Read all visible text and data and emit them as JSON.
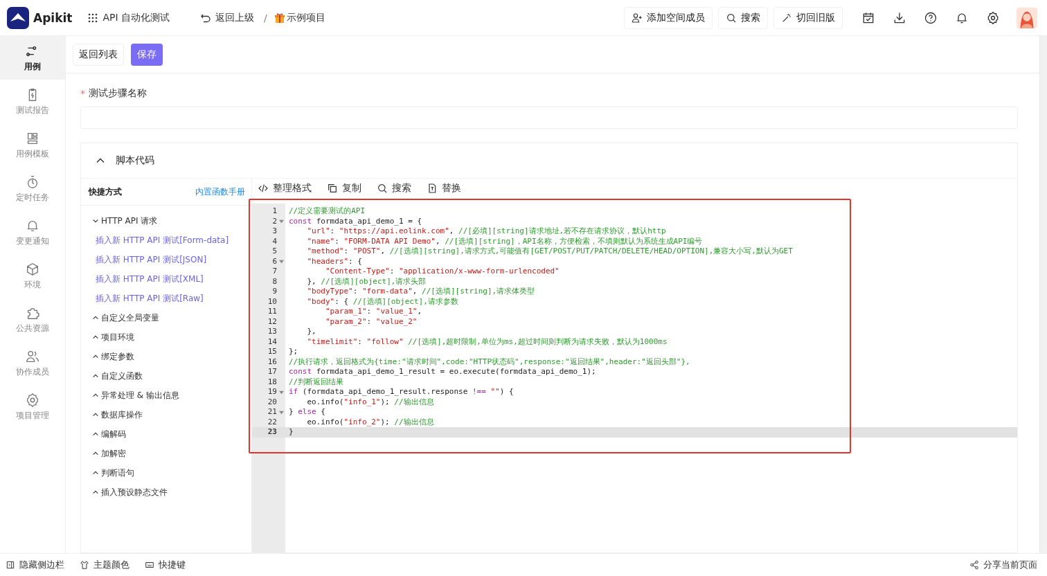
{
  "header": {
    "logo": "Apikit",
    "workspace": "API 自动化测试",
    "back": "返回上级",
    "separator": "/",
    "project": "示例项目",
    "actions": [
      "添加空间成员",
      "搜索",
      "切回旧版"
    ]
  },
  "sidebar": {
    "items": [
      {
        "label": "用例",
        "selected": true
      },
      {
        "label": "测试报告",
        "selected": false
      },
      {
        "label": "用例模板",
        "selected": false
      },
      {
        "label": "定时任务",
        "selected": false
      },
      {
        "label": "变更通知",
        "selected": false
      },
      {
        "label": "环境",
        "selected": false
      },
      {
        "label": "公共资源",
        "selected": false
      },
      {
        "label": "协作成员",
        "selected": false
      },
      {
        "label": "项目管理",
        "selected": false
      }
    ]
  },
  "toolbar": {
    "back_button": "返回列表",
    "save_button": "保存"
  },
  "step_name": {
    "label": "测试步骤名称",
    "required_mark": "*"
  },
  "script_section": {
    "title": "脚本代码",
    "expanded": true,
    "shortcuts": {
      "title": "快捷方式",
      "manual_link": "内置函数手册",
      "groups": [
        {
          "label": "HTTP API 请求",
          "expanded": true,
          "children": [
            {
              "label": "插入新 HTTP API 测试[Form-data]"
            },
            {
              "label": "插入新 HTTP API 测试[JSON]"
            },
            {
              "label": "插入新 HTTP API 测试[XML]"
            },
            {
              "label": "插入新 HTTP API 测试[Raw]"
            }
          ]
        },
        {
          "label": "自定义全局变量",
          "expanded": false
        },
        {
          "label": "项目环境",
          "expanded": false
        },
        {
          "label": "绑定参数",
          "expanded": false
        },
        {
          "label": "自定义函数",
          "expanded": false
        },
        {
          "label": "异常处理 & 输出信息",
          "expanded": false
        },
        {
          "label": "数据库操作",
          "expanded": false
        },
        {
          "label": "编解码",
          "expanded": false
        },
        {
          "label": "加解密",
          "expanded": false
        },
        {
          "label": "判断语句",
          "expanded": false
        },
        {
          "label": "插入预设静态文件",
          "expanded": false
        }
      ]
    },
    "editor_tools": [
      "整理格式",
      "复制",
      "搜索",
      "替换"
    ],
    "code_lines": [
      {
        "number": "1",
        "foldable": false,
        "active": false,
        "tokens": [
          {
            "kind": "comment",
            "text": "//定义需要测试的API"
          }
        ]
      },
      {
        "number": "2",
        "foldable": true,
        "active": false,
        "tokens": [
          {
            "kind": "keyword",
            "text": "const"
          },
          {
            "kind": "plain",
            "text": " formdata_api_demo_1 = {"
          }
        ]
      },
      {
        "number": "3",
        "foldable": false,
        "active": false,
        "tokens": [
          {
            "kind": "string",
            "text": "    \"url\""
          },
          {
            "kind": "plain",
            "text": ": "
          },
          {
            "kind": "string",
            "text": "\"https://api.eolink.com\""
          },
          {
            "kind": "plain",
            "text": ", "
          },
          {
            "kind": "comment",
            "text": "//[必填][string]请求地址,若不存在请求协议，默认http"
          }
        ]
      },
      {
        "number": "4",
        "foldable": false,
        "active": false,
        "tokens": [
          {
            "kind": "string",
            "text": "    \"name\""
          },
          {
            "kind": "plain",
            "text": ": "
          },
          {
            "kind": "string",
            "text": "\"FORM-DATA API Demo\""
          },
          {
            "kind": "plain",
            "text": ", "
          },
          {
            "kind": "comment",
            "text": "//[选填][string]，API名称，方便检索，不填则默认为系统生成API编号"
          }
        ]
      },
      {
        "number": "5",
        "foldable": false,
        "active": false,
        "tokens": [
          {
            "kind": "string",
            "text": "    \"method\""
          },
          {
            "kind": "plain",
            "text": ": "
          },
          {
            "kind": "string",
            "text": "\"POST\""
          },
          {
            "kind": "plain",
            "text": ", "
          },
          {
            "kind": "comment",
            "text": "//[选填][string],请求方式,可能值有[GET/POST/PUT/PATCH/DELETE/HEAD/OPTION],兼容大小写,默认为GET"
          }
        ]
      },
      {
        "number": "6",
        "foldable": true,
        "active": false,
        "tokens": [
          {
            "kind": "string",
            "text": "    \"headers\""
          },
          {
            "kind": "plain",
            "text": ": {"
          }
        ]
      },
      {
        "number": "7",
        "foldable": false,
        "active": false,
        "tokens": [
          {
            "kind": "string",
            "text": "        \"Content-Type\""
          },
          {
            "kind": "plain",
            "text": ": "
          },
          {
            "kind": "string",
            "text": "\"application/x-www-form-urlencoded\""
          }
        ]
      },
      {
        "number": "8",
        "foldable": false,
        "active": false,
        "tokens": [
          {
            "kind": "plain",
            "text": "    }, "
          },
          {
            "kind": "comment",
            "text": "//[选填][object],请求头部"
          }
        ]
      },
      {
        "number": "9",
        "foldable": false,
        "active": false,
        "tokens": [
          {
            "kind": "string",
            "text": "    \"bodyType\""
          },
          {
            "kind": "plain",
            "text": ": "
          },
          {
            "kind": "string",
            "text": "\"form-data\""
          },
          {
            "kind": "plain",
            "text": ", "
          },
          {
            "kind": "comment",
            "text": "//[选填][string],请求体类型"
          }
        ]
      },
      {
        "number": "10",
        "foldable": false,
        "active": false,
        "tokens": [
          {
            "kind": "string",
            "text": "    \"body\""
          },
          {
            "kind": "plain",
            "text": ": { "
          },
          {
            "kind": "comment",
            "text": "//[选填][object],请求参数"
          }
        ]
      },
      {
        "number": "11",
        "foldable": false,
        "active": false,
        "tokens": [
          {
            "kind": "string",
            "text": "        \"param_1\""
          },
          {
            "kind": "plain",
            "text": ": "
          },
          {
            "kind": "string",
            "text": "\"value_1\""
          },
          {
            "kind": "plain",
            "text": ","
          }
        ]
      },
      {
        "number": "12",
        "foldable": false,
        "active": false,
        "tokens": [
          {
            "kind": "string",
            "text": "        \"param_2\""
          },
          {
            "kind": "plain",
            "text": ": "
          },
          {
            "kind": "string",
            "text": "\"value_2\""
          }
        ]
      },
      {
        "number": "13",
        "foldable": false,
        "active": false,
        "tokens": [
          {
            "kind": "plain",
            "text": "    },"
          }
        ]
      },
      {
        "number": "14",
        "foldable": false,
        "active": false,
        "tokens": [
          {
            "kind": "string",
            "text": "    \"timelimit\""
          },
          {
            "kind": "plain",
            "text": ": "
          },
          {
            "kind": "string",
            "text": "\"follow\""
          },
          {
            "kind": "comment",
            "text": " //[选填],超时限制,单位为ms,超过时间则判断为请求失败，默认为1000ms"
          }
        ]
      },
      {
        "number": "15",
        "foldable": false,
        "active": false,
        "tokens": [
          {
            "kind": "plain",
            "text": "};"
          }
        ]
      },
      {
        "number": "16",
        "foldable": false,
        "active": false,
        "tokens": [
          {
            "kind": "comment",
            "text": "//执行请求，返回格式为{time:\"请求时间\",code:\"HTTP状态码\",response:\"返回结果\",header:\"返回头部\"},"
          }
        ]
      },
      {
        "number": "17",
        "foldable": false,
        "active": false,
        "tokens": [
          {
            "kind": "keyword",
            "text": "const"
          },
          {
            "kind": "plain",
            "text": " formdata_api_demo_1_result = eo.execute(formdata_api_demo_1);"
          }
        ]
      },
      {
        "number": "18",
        "foldable": false,
        "active": false,
        "tokens": [
          {
            "kind": "comment",
            "text": "//判断返回结果"
          }
        ]
      },
      {
        "number": "19",
        "foldable": true,
        "active": false,
        "tokens": [
          {
            "kind": "keyword",
            "text": "if"
          },
          {
            "kind": "plain",
            "text": " (formdata_api_demo_1_result.response "
          },
          {
            "kind": "keyword",
            "text": "!=="
          },
          {
            "kind": "string",
            "text": " \"\""
          },
          {
            "kind": "plain",
            "text": ") {"
          }
        ]
      },
      {
        "number": "20",
        "foldable": false,
        "active": false,
        "tokens": [
          {
            "kind": "plain",
            "text": "    eo.info("
          },
          {
            "kind": "string",
            "text": "\"info_1\""
          },
          {
            "kind": "plain",
            "text": "); "
          },
          {
            "kind": "comment",
            "text": "//输出信息"
          }
        ]
      },
      {
        "number": "21",
        "foldable": true,
        "active": false,
        "tokens": [
          {
            "kind": "plain",
            "text": "} "
          },
          {
            "kind": "keyword",
            "text": "else"
          },
          {
            "kind": "plain",
            "text": " {"
          }
        ]
      },
      {
        "number": "22",
        "foldable": false,
        "active": false,
        "tokens": [
          {
            "kind": "plain",
            "text": "    eo.info("
          },
          {
            "kind": "string",
            "text": "\"info_2\""
          },
          {
            "kind": "plain",
            "text": "); "
          },
          {
            "kind": "comment",
            "text": "//输出信息"
          }
        ]
      },
      {
        "number": "23",
        "foldable": false,
        "active": true,
        "tokens": [
          {
            "kind": "plain",
            "text": "}"
          }
        ]
      }
    ]
  },
  "footer": {
    "left": [
      "隐藏侧边栏",
      "主题颜色",
      "快捷键"
    ],
    "share": "分享当前页面"
  }
}
